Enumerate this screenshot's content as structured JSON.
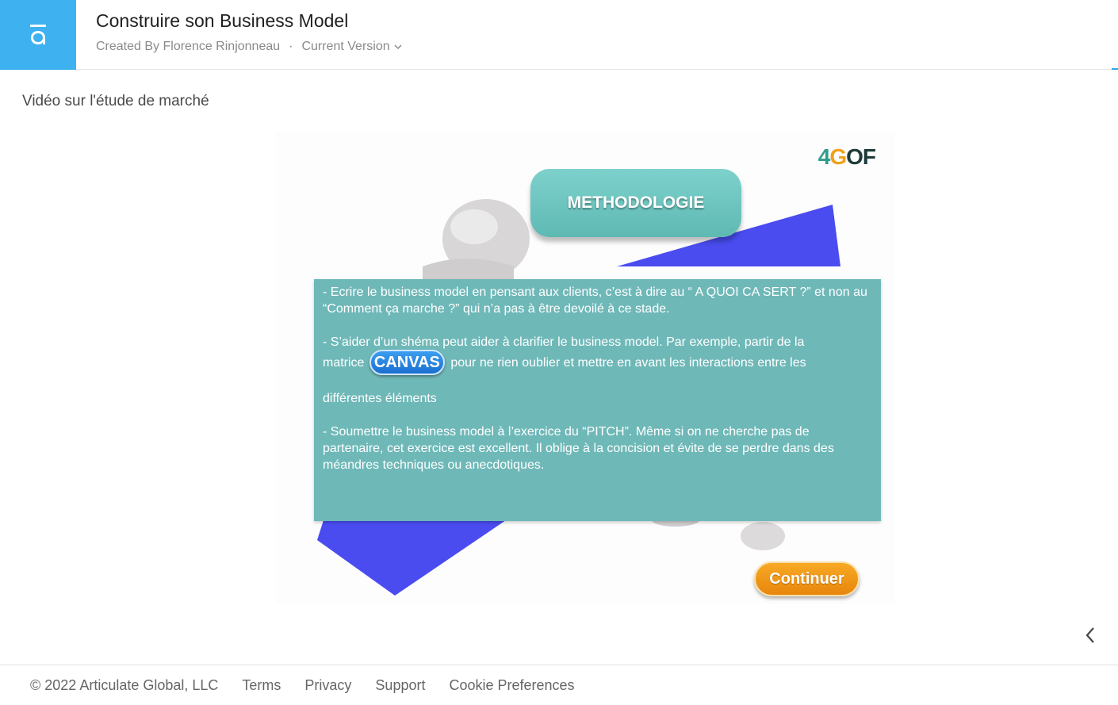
{
  "header": {
    "title": "Construire son Business Model",
    "created_by": "Created By Florence Rinjonneau",
    "separator": "·",
    "version_label": "Current Version",
    "brand_color": "#3eb1f0"
  },
  "lesson": {
    "title": "Vidéo sur l'étude de marché"
  },
  "slide": {
    "brand_part1": "4",
    "brand_part2": "G",
    "brand_part3": "OF",
    "heading": "METHODOLOGIE",
    "para1": "- Ecrire le business model en pensant aux clients, c’est à dire au “ A QUOI CA SERT ?” et non au “Comment ça marche ?” qui n’a pas à être devoilé à ce stade.",
    "para2_line1": "- S’aider d’un shéma peut aider à clarifier le business model. Par exemple, partir de la",
    "para2_before": "matrice",
    "canvas_label": "CANVAS",
    "para2_after": "pour ne rien oublier et mettre en avant les interactions entre les",
    "para2_end": "différentes éléments",
    "para3": "- Soumettre le business model à l’exercice du “PITCH”. Même si on ne cherche pas de partenaire, cet exercice est excellent. Il oblige à la concision et évite de se perdre dans des méandres techniques ou anecdotiques.",
    "continue_label": "Continuer",
    "colors": {
      "teal_box": "#6fb8b8",
      "triangle": "#4a4cf0",
      "continue": "#f09a18",
      "canvas": "#1f7fe0"
    }
  },
  "icons": {
    "logo": "articulate-logo-icon",
    "version_dropdown": "chevron-down-icon",
    "prev": "chevron-left-icon"
  },
  "footer": {
    "copyright": "© 2022 Articulate Global, LLC",
    "terms": "Terms",
    "privacy": "Privacy",
    "support": "Support",
    "cookie": "Cookie Preferences"
  }
}
